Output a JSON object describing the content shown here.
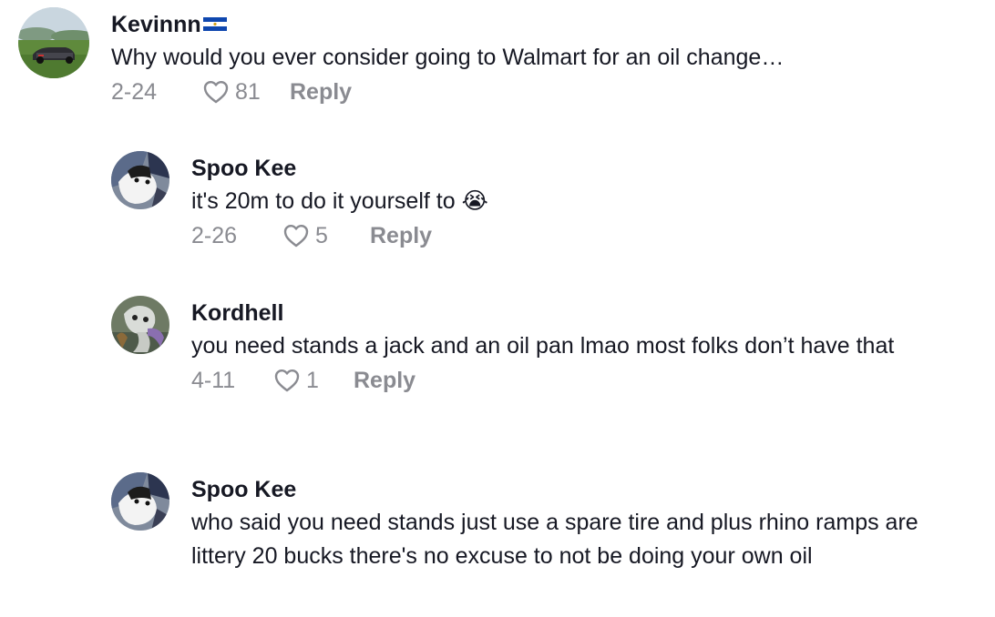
{
  "comments": [
    {
      "username": "Kevinnn",
      "text": "Why would you ever consider going to Walmart for an oil change…",
      "date": "2-24",
      "likes": "81",
      "reply_label": "Reply"
    },
    {
      "username": "Spoo Kee",
      "text": "it's 20m to do it yourself to 😭",
      "date": "2-26",
      "likes": "5",
      "reply_label": "Reply"
    },
    {
      "username": "Kordhell",
      "text": "you need stands a jack and an oil pan lmao most folks don’t have that",
      "date": "4-11",
      "likes": "1",
      "reply_label": "Reply"
    },
    {
      "username": "Spoo Kee",
      "text": "who said you need stands just use a spare tire and plus rhino ramps are littery 20 bucks there's no excuse to not be doing your own oil"
    }
  ],
  "icons": {
    "like": "heart-outline-icon",
    "flag": "el-salvador-flag-icon"
  },
  "colors": {
    "text": "#161823",
    "meta": "#8a8b91"
  }
}
